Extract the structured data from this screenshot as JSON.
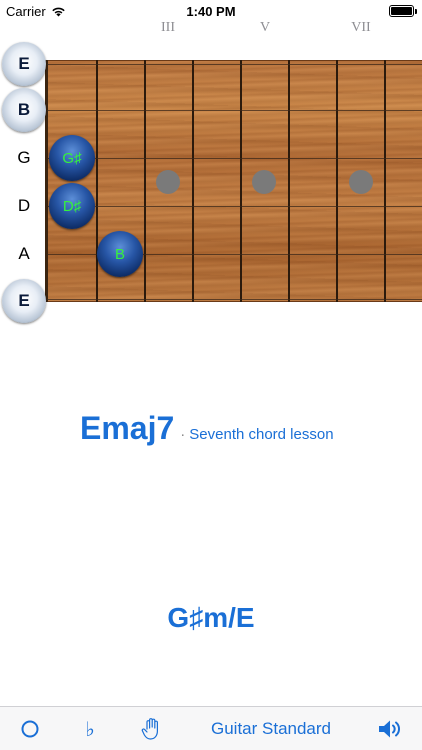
{
  "status_bar": {
    "carrier": "Carrier",
    "time": "1:40 PM"
  },
  "fret_markers": [
    {
      "label": "III"
    },
    {
      "label": "V"
    },
    {
      "label": "VII"
    }
  ],
  "strings": [
    {
      "name": "E",
      "open": true
    },
    {
      "name": "B",
      "open": true
    },
    {
      "name": "G",
      "open": false
    },
    {
      "name": "D",
      "open": false
    },
    {
      "name": "A",
      "open": false
    },
    {
      "name": "E",
      "open": true
    }
  ],
  "notes": [
    {
      "label": "G♯",
      "string": "G",
      "fret": 1
    },
    {
      "label": "D♯",
      "string": "D",
      "fret": 1
    },
    {
      "label": "B",
      "string": "A",
      "fret": 2
    }
  ],
  "chord": {
    "name": "Emaj7",
    "separator": "·",
    "description": "Seventh chord lesson",
    "alternate": "G♯m/E"
  },
  "toolbar": {
    "circle_icon": "circle-icon",
    "flat_icon": "flat-icon",
    "flat_glyph": "♭",
    "hand_icon": "hand-icon",
    "tuning_label": "Guitar Standard",
    "speaker_icon": "speaker-icon"
  },
  "colors": {
    "accent": "#1a6fd6",
    "note_text": "#35f23c"
  }
}
